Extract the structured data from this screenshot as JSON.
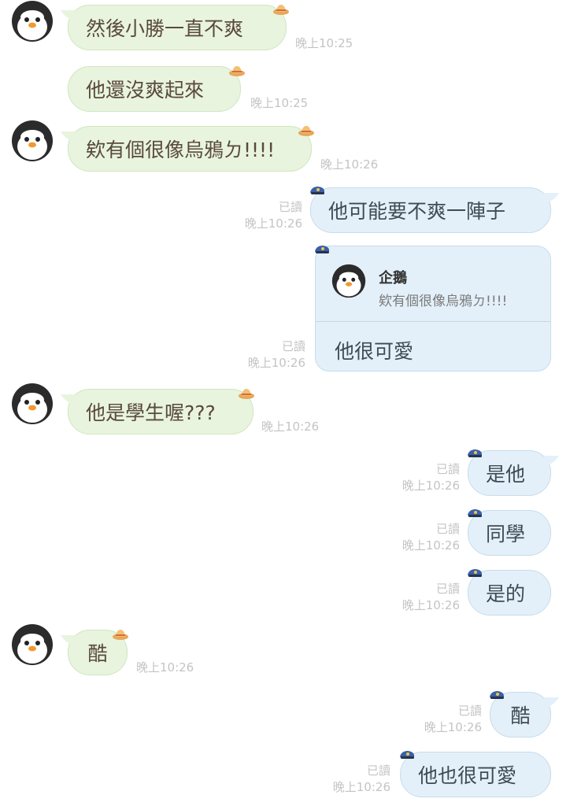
{
  "contact": {
    "name": "企鵝"
  },
  "messages": [
    {
      "text": "然後小勝一直不爽",
      "time": "晚上10:25"
    },
    {
      "text": "他還沒爽起來",
      "time": "晚上10:25"
    },
    {
      "text": "欸有個很像烏鴉ㄉ!!!!",
      "time": "晚上10:26"
    },
    {
      "text": "他可能要不爽一陣子",
      "read": "已讀",
      "time": "晚上10:26"
    },
    {
      "reply_name": "企鵝",
      "reply_quote": "欸有個很像烏鴉ㄉ!!!!",
      "text": "他很可愛",
      "read": "已讀",
      "time": "晚上10:26"
    },
    {
      "text": "他是學生喔???",
      "time": "晚上10:26"
    },
    {
      "text": "是他",
      "read": "已讀",
      "time": "晚上10:26"
    },
    {
      "text": "同學",
      "read": "已讀",
      "time": "晚上10:26"
    },
    {
      "text": "是的",
      "read": "已讀",
      "time": "晚上10:26"
    },
    {
      "text": "酷",
      "time": "晚上10:26"
    },
    {
      "text": "酷",
      "read": "已讀",
      "time": "晚上10:26"
    },
    {
      "text": "他也很可愛",
      "read": "已讀",
      "time": "晚上10:26"
    }
  ],
  "colors": {
    "incoming_bubble": "#e8f4de",
    "outgoing_bubble": "#e4f0f9",
    "timestamp": "#c4c4c4"
  },
  "icons": {
    "avatar": "penguin-avatar-icon",
    "sticker_hat_left": "straw-hat-icon",
    "sticker_hat_right": "police-cap-icon"
  }
}
